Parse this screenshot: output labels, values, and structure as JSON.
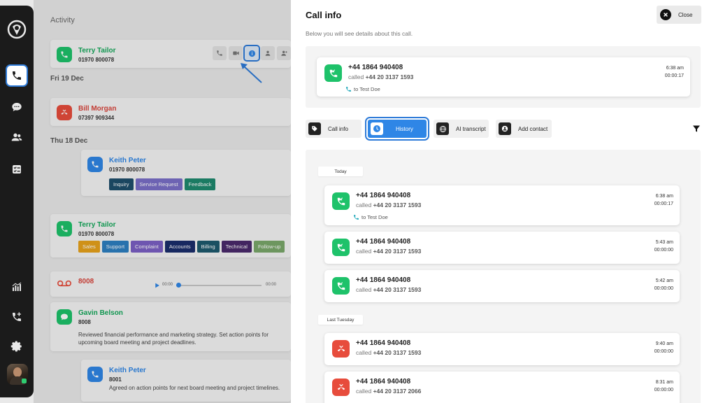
{
  "nav": {
    "items": [
      {
        "name": "calls",
        "icon": "phone-icon",
        "active": true
      },
      {
        "name": "messages",
        "icon": "chat-icon"
      },
      {
        "name": "contacts",
        "icon": "contacts-icon"
      },
      {
        "name": "tasks",
        "icon": "checklist-icon"
      },
      {
        "name": "reports",
        "icon": "bar-chart-icon"
      },
      {
        "name": "add-call",
        "icon": "phone-plus-icon"
      },
      {
        "name": "settings",
        "icon": "gear-icon"
      }
    ]
  },
  "feed": {
    "heading": "Activity",
    "dates": [
      "Fri 19 Dec",
      "Thu 18 Dec"
    ],
    "entries": [
      {
        "name": "Terry Tailor",
        "phone": "01970 800078"
      },
      {
        "name": "Bill Morgan",
        "phone": "07397 909344"
      },
      {
        "name": "Keith Peter",
        "phone": "01970 800078",
        "tags": [
          "Inquiry",
          "Service Request",
          "Feedback"
        ]
      },
      {
        "name": "Terry Tailor",
        "phone": "01970 800078",
        "tags": [
          "Sales",
          "Support",
          "Complaint",
          "Accounts",
          "Billing",
          "Technical",
          "Follow-up"
        ]
      },
      {
        "name": "8008",
        "voicemail_time_start": "00:00",
        "voicemail_time_end": "00:00"
      },
      {
        "name": "Gavin Belson",
        "phone": "8008",
        "note": "Reviewed financial performance and marketing strategy. Set action points for upcoming board meeting and project deadlines."
      },
      {
        "name": "Keith Peter",
        "phone": "8001",
        "note": "Agreed on action points for next board meeting and project timelines."
      }
    ]
  },
  "panel": {
    "title": "Call info",
    "subtitle": "Below you will see details about this call.",
    "close_label": "Close",
    "summary": {
      "number": "+44 1864 940408",
      "called_prefix": "called ",
      "called_number": "+44 20 3137 1593",
      "time": "6:38 am",
      "duration": "00:00:17",
      "to_prefix": "to ",
      "to_name": "Test Doe"
    },
    "tabs": [
      {
        "label": "Call info",
        "icon": "tag-icon"
      },
      {
        "label": "History",
        "icon": "clock-icon",
        "active": true
      },
      {
        "label": "AI transcript",
        "icon": "globe-icon"
      },
      {
        "label": "Add contact",
        "icon": "add-contact-icon"
      }
    ],
    "history": {
      "groups": [
        {
          "label": "Today",
          "calls": [
            {
              "number": "+44 1864 940408",
              "called": "+44 20 3137 1593",
              "time": "6:38 am",
              "duration": "00:00:17",
              "to": "Test Doe",
              "status": "answered"
            },
            {
              "number": "+44 1864 940408",
              "called": "+44 20 3137 1593",
              "time": "5:43 am",
              "duration": "00:00:00",
              "status": "answered"
            },
            {
              "number": "+44 1864 940408",
              "called": "+44 20 3137 1593",
              "time": "5:42 am",
              "duration": "00:00:00",
              "status": "answered"
            }
          ]
        },
        {
          "label": "Last Tuesday",
          "calls": [
            {
              "number": "+44 1864 940408",
              "called": "+44 20 3137 1593",
              "time": "9:40 am",
              "duration": "00:00:00",
              "status": "missed"
            },
            {
              "number": "+44 1864 940408",
              "called": "+44 20 3137 2066",
              "time": "8:31 am",
              "duration": "00:00:00",
              "status": "missed"
            }
          ]
        }
      ]
    }
  },
  "colors": {
    "answered": "#1ec26a",
    "missed": "#e74c3c",
    "accent": "#2f86e6"
  }
}
